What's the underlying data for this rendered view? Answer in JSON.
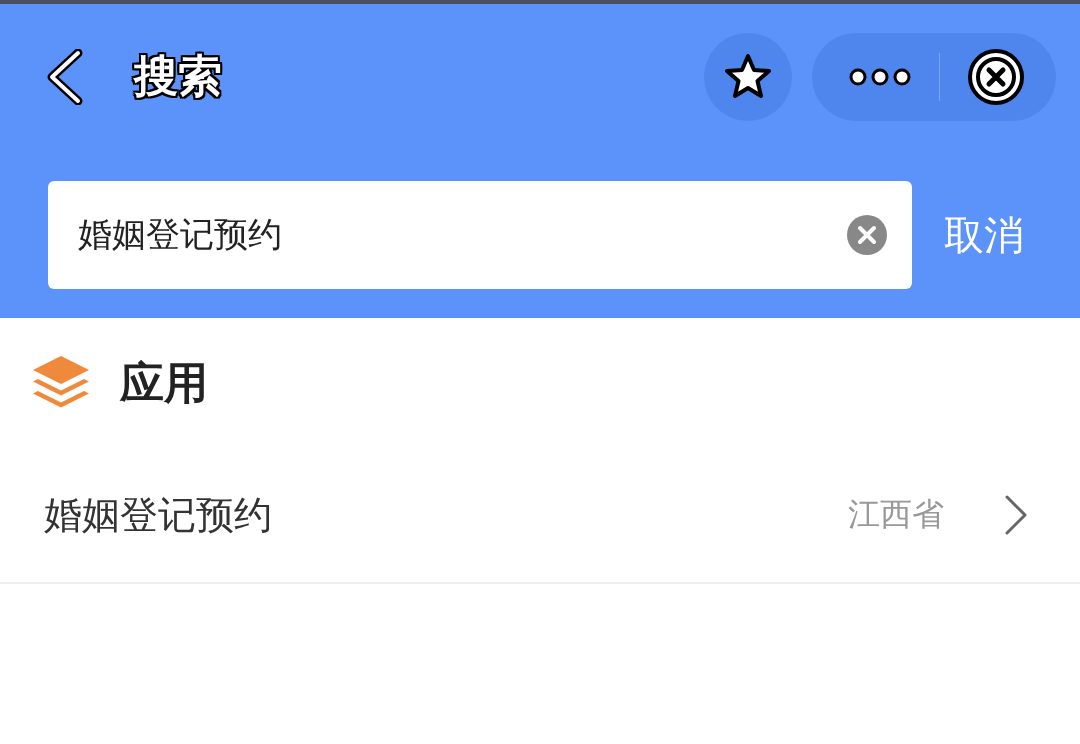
{
  "header": {
    "title": "搜索"
  },
  "search": {
    "value": "婚姻登记预约",
    "cancel": "取消"
  },
  "section": {
    "title": "应用"
  },
  "results": [
    {
      "name": "婚姻登记预约",
      "region": "江西省"
    }
  ]
}
